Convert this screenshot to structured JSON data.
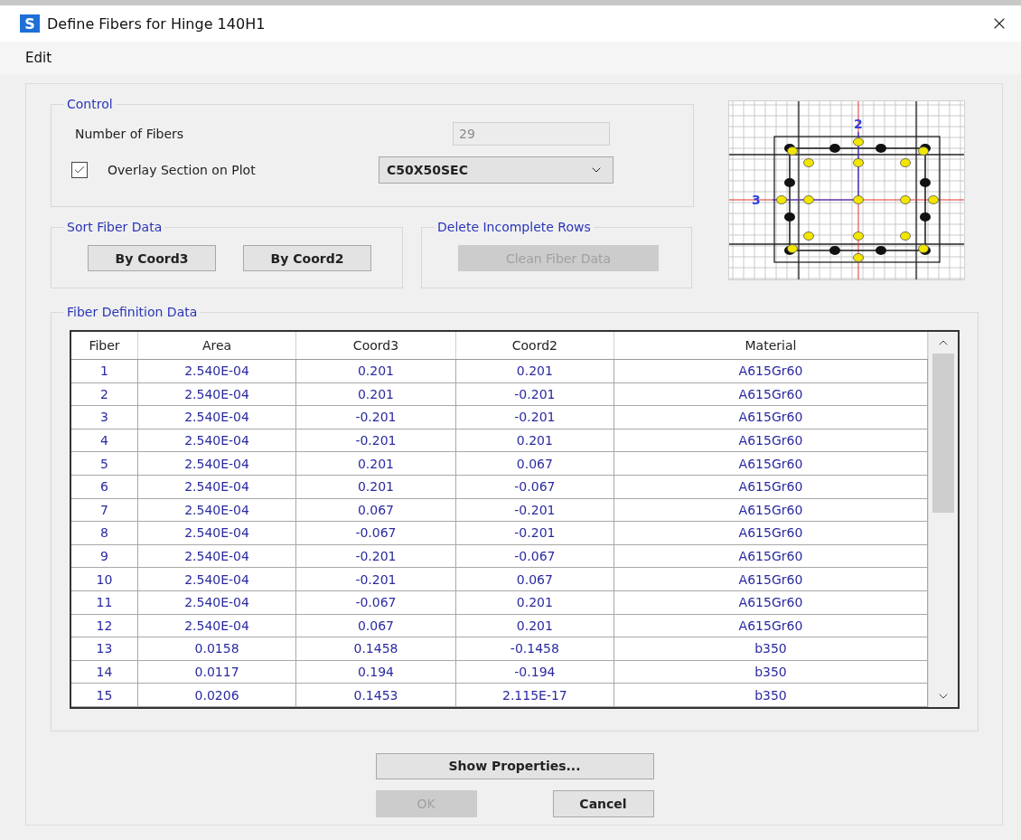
{
  "window": {
    "title": "Define Fibers for Hinge 140H1",
    "app_icon": "S"
  },
  "menu": [
    {
      "label": "Edit"
    }
  ],
  "control": {
    "title": "Control",
    "number_of_fibers": {
      "label": "Number of Fibers",
      "value": "29",
      "disabled": true
    },
    "overlay": {
      "label": "Overlay Section on Plot",
      "checked": true
    },
    "section_select": {
      "value": "C50X50SEC"
    }
  },
  "plot": {
    "axis_labels": [
      "2",
      "3"
    ]
  },
  "sort": {
    "title": "Sort Fiber Data",
    "buttons": [
      {
        "label": "By Coord3",
        "disabled": false
      },
      {
        "label": "By Coord2",
        "disabled": false
      }
    ]
  },
  "delete": {
    "title": "Delete Incomplete Rows",
    "button": {
      "label": "Clean Fiber Data",
      "disabled": true
    }
  },
  "fiber_table": {
    "title": "Fiber Definition Data",
    "columns": [
      "Fiber",
      "Area",
      "Coord3",
      "Coord2",
      "Material"
    ],
    "rows": [
      [
        "1",
        "2.540E-04",
        "0.201",
        "0.201",
        "A615Gr60"
      ],
      [
        "2",
        "2.540E-04",
        "0.201",
        "-0.201",
        "A615Gr60"
      ],
      [
        "3",
        "2.540E-04",
        "-0.201",
        "-0.201",
        "A615Gr60"
      ],
      [
        "4",
        "2.540E-04",
        "-0.201",
        "0.201",
        "A615Gr60"
      ],
      [
        "5",
        "2.540E-04",
        "0.201",
        "0.067",
        "A615Gr60"
      ],
      [
        "6",
        "2.540E-04",
        "0.201",
        "-0.067",
        "A615Gr60"
      ],
      [
        "7",
        "2.540E-04",
        "0.067",
        "-0.201",
        "A615Gr60"
      ],
      [
        "8",
        "2.540E-04",
        "-0.067",
        "-0.201",
        "A615Gr60"
      ],
      [
        "9",
        "2.540E-04",
        "-0.201",
        "-0.067",
        "A615Gr60"
      ],
      [
        "10",
        "2.540E-04",
        "-0.201",
        "0.067",
        "A615Gr60"
      ],
      [
        "11",
        "2.540E-04",
        "-0.067",
        "0.201",
        "A615Gr60"
      ],
      [
        "12",
        "2.540E-04",
        "0.067",
        "0.201",
        "A615Gr60"
      ],
      [
        "13",
        "0.0158",
        "0.1458",
        "-0.1458",
        "b350"
      ],
      [
        "14",
        "0.0117",
        "0.194",
        "-0.194",
        "b350"
      ],
      [
        "15",
        "0.0206",
        "0.1453",
        "2.115E-17",
        "b350"
      ]
    ]
  },
  "show_properties": {
    "label": "Show Properties...",
    "disabled": false
  },
  "buttons": [
    {
      "label": "OK",
      "disabled": true
    },
    {
      "label": "Cancel",
      "disabled": false
    }
  ]
}
